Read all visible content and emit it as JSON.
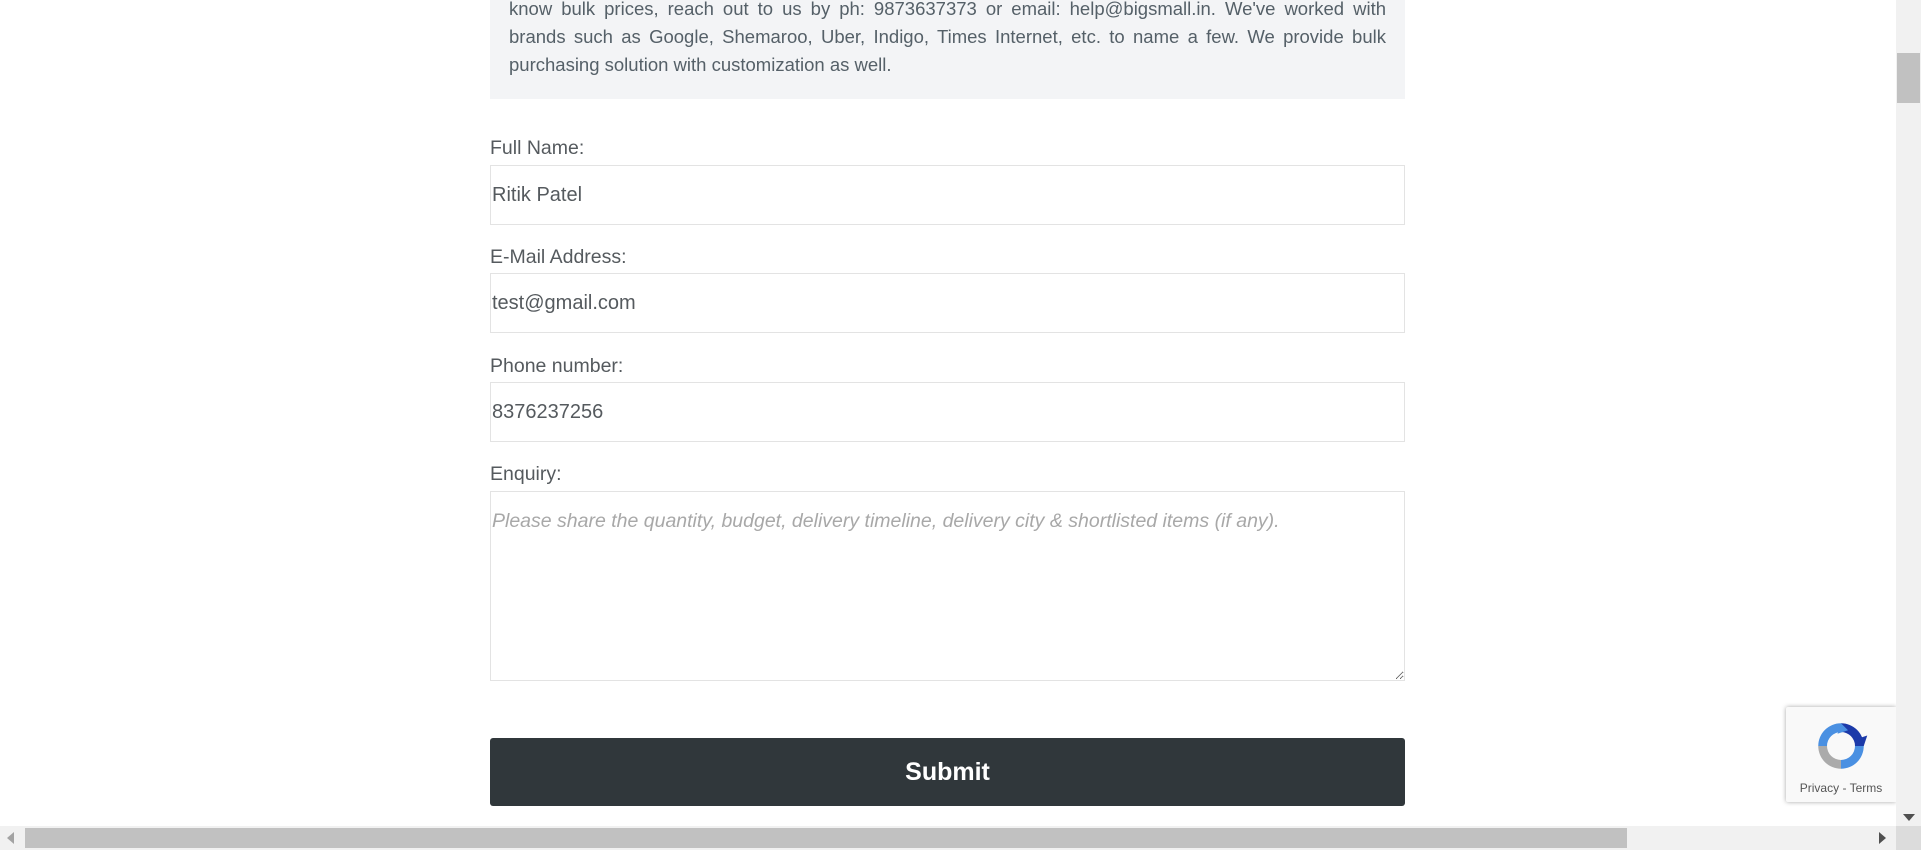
{
  "info_box": {
    "text": "know bulk prices, reach out to us by ph: 9873637373 or email: help@bigsmall.in. We've worked with brands such as Google, Shemaroo, Uber, Indigo, Times Internet, etc. to name a few. We provide bulk purchasing solution with customization as well."
  },
  "form": {
    "full_name": {
      "label": "Full Name:",
      "value": "Ritik Patel"
    },
    "email": {
      "label": "E-Mail Address:",
      "value": "test@gmail.com"
    },
    "phone": {
      "label": "Phone number:",
      "value": "8376237256"
    },
    "enquiry": {
      "label": "Enquiry:",
      "placeholder": "Please share the quantity, budget, delivery timeline, delivery city & shortlisted items (if any).",
      "value": ""
    },
    "submit_label": "Submit"
  },
  "recaptcha": {
    "privacy_label": "Privacy",
    "separator": "-",
    "terms_label": "Terms",
    "icon": "recaptcha-icon"
  },
  "colors": {
    "submit_bg": "#30373b",
    "info_bg": "#f3f4f6",
    "text": "#555a5e"
  }
}
